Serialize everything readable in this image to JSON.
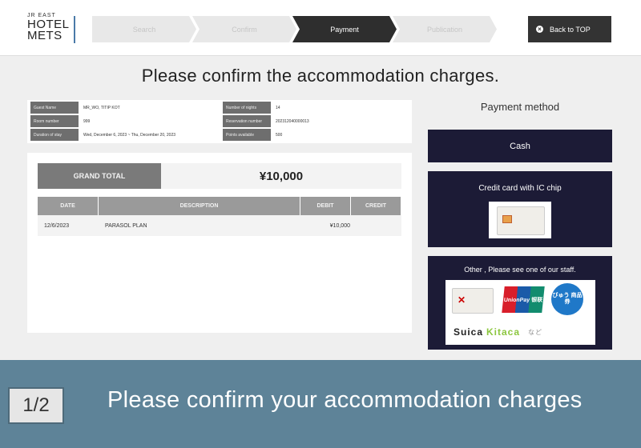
{
  "logo": {
    "small": "JR EAST",
    "line1": "HOTEL",
    "line2": "METS"
  },
  "steps": [
    {
      "label": "Search"
    },
    {
      "label": "Confirm"
    },
    {
      "label": "Payment"
    },
    {
      "label": "Publication"
    }
  ],
  "back_button": {
    "label": "Back to TOP"
  },
  "title": "Please confirm the accommodation charges.",
  "info": {
    "guest_name_label": "Guest Name",
    "guest_name": "MR_WO, TITIP KOT",
    "room_number_label": "Room number",
    "room_number": "999",
    "duration_label": "Duration of stay",
    "duration": "Wed, December 6, 2023 ~ Thu, December 20, 2023",
    "num_nights_label": "Number of nights",
    "num_nights": "14",
    "reservation_number_label": "Reservation number",
    "reservation_number": "202312040000013",
    "points_label": "Points available",
    "points": "500"
  },
  "bill": {
    "grand_total_label": "GRAND TOTAL",
    "grand_total": "¥10,000",
    "columns": [
      "DATE",
      "DESCRIPTION",
      "DEBIT",
      "CREDIT"
    ],
    "rows": [
      {
        "date": "12/6/2023",
        "description": "PARASOL PLAN",
        "debit": "¥10,000",
        "credit": ""
      }
    ]
  },
  "payment": {
    "title": "Payment method",
    "cash": "Cash",
    "credit_card": "Credit card with IC chip",
    "other": "Other , Please see one of our staff.",
    "unionpay_label": "UnionPay 银联",
    "badge_label": "びゅう 商品券",
    "ic_cards": [
      "Suica",
      "Kitaca"
    ],
    "etc": "など"
  },
  "caption": {
    "page": "1/2",
    "text": "Please confirm your accommodation charges"
  }
}
